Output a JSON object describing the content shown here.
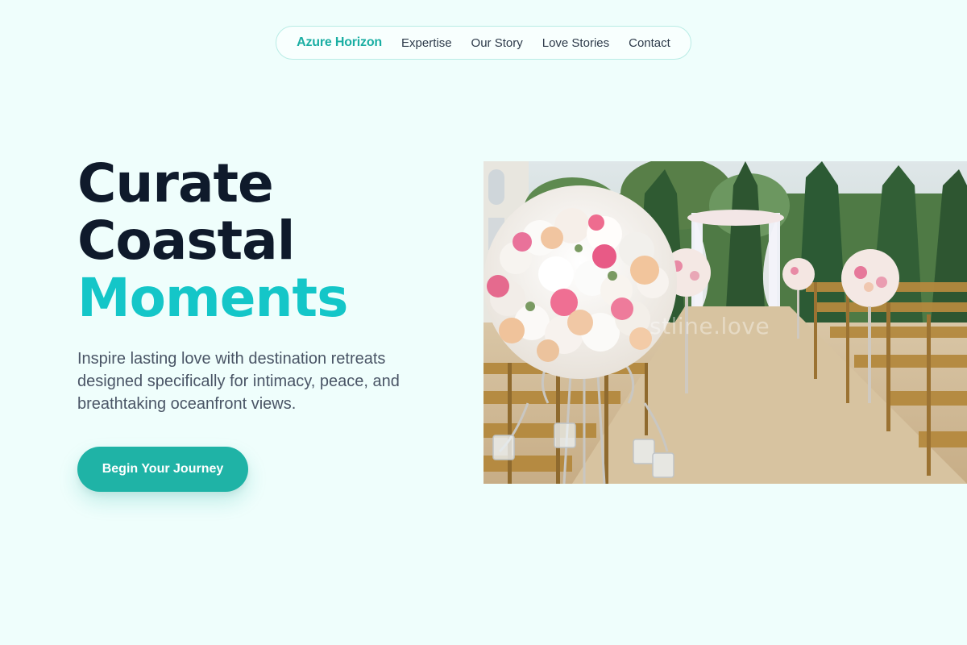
{
  "nav": {
    "brand": "Azure Horizon",
    "links": [
      "Expertise",
      "Our Story",
      "Love Stories",
      "Contact"
    ]
  },
  "hero": {
    "title_lines": [
      "Curate",
      "Coastal",
      "Moments"
    ],
    "description": "Inspire lasting love with destination retreats designed specifically for intimacy, peace, and breathtaking oceanfront views.",
    "cta_label": "Begin Your Journey",
    "image_watermark": "stline.love"
  },
  "colors": {
    "background": "#effefc",
    "brand": "#1aaea3",
    "accent": "#14c6c8",
    "heading": "#0f1a2b",
    "cta": "#1fb3a6"
  }
}
